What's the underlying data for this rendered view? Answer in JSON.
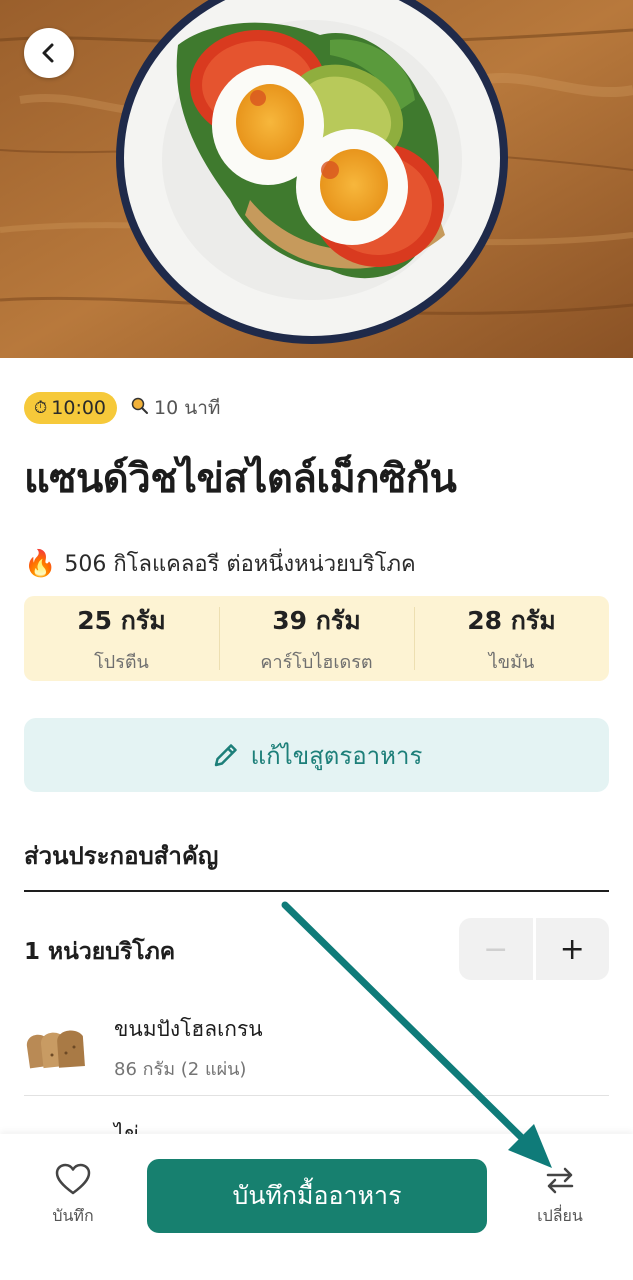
{
  "hero": {
    "image_alt": "open sandwich with tomato, avocado and boiled eggs on a plate"
  },
  "header": {
    "back_icon": "chevron-left-icon"
  },
  "meta": {
    "time_badge": "10:00",
    "time_badge_icon": "alarm-clock-icon",
    "duration": "10 นาที",
    "duration_icon": "pan-icon"
  },
  "recipe": {
    "title": "แซนด์วิชไข่สไตล์เม็กซิกัน",
    "calories_text": "506 กิโลแคลอรี ต่อหนึ่งหน่วยบริโภค",
    "calories_icon": "flame-icon"
  },
  "macros": [
    {
      "value": "25 กรัม",
      "label": "โปรตีน"
    },
    {
      "value": "39 กรัม",
      "label": "คาร์โบไฮเดรต"
    },
    {
      "value": "28 กรัม",
      "label": "ไขมัน"
    }
  ],
  "edit_button": {
    "label": "แก้ไขสูตรอาหาร",
    "icon": "pencil-icon"
  },
  "ingredients_section": {
    "title": "ส่วนประกอบสำคัญ",
    "serving_label": "1 หน่วยบริโภค",
    "minus_label": "−",
    "plus_label": "+",
    "items": [
      {
        "name": "ขนมปังโฮลเกรน",
        "qty": "86 กรัม (2 แผ่น)"
      },
      {
        "name": "ไข่",
        "qty": ""
      }
    ]
  },
  "bottom_bar": {
    "save_label": "บันทึก",
    "log_button": "บันทึกมื้ออาหาร",
    "swap_label": "เปลี่ยน"
  },
  "colors": {
    "accent": "#17806f",
    "badge": "#f6c93a",
    "macro_bg": "#fdf3d3",
    "edit_bg": "#e4f3f3",
    "annotation_arrow": "#0f7b79"
  }
}
